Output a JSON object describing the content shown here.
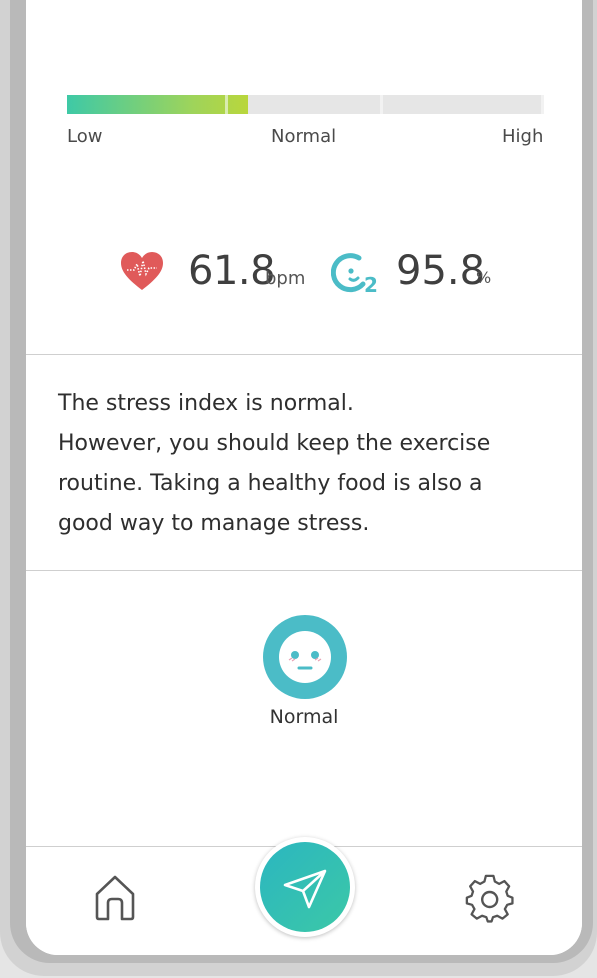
{
  "stress_scale": {
    "level_fraction": 0.38,
    "labels": {
      "low": "Low",
      "normal": "Normal",
      "high": "High"
    },
    "colors": {
      "fill_start": "#3ec9a6",
      "fill_end": "#b9d63c",
      "track": "#e6e6e6"
    }
  },
  "metrics": {
    "heart_rate": {
      "value": "61.8",
      "unit": "bpm",
      "icon": "heart-icon",
      "color": "#e05a5a"
    },
    "oxygen": {
      "value": "95.8",
      "unit": "%",
      "icon": "o2-icon",
      "color": "#4bbcc7"
    }
  },
  "advice": {
    "line1": "The stress index is normal.",
    "line2": "However, you should keep the exercise",
    "line3": "routine. Taking a healthy food is also a",
    "line4": "good way to manage stress."
  },
  "mood": {
    "icon": "neutral-face-icon",
    "label": "Normal",
    "color": "#4bbcc7"
  },
  "nav": {
    "home_icon": "home-icon",
    "send_icon": "paper-plane-icon",
    "settings_icon": "gear-icon"
  }
}
